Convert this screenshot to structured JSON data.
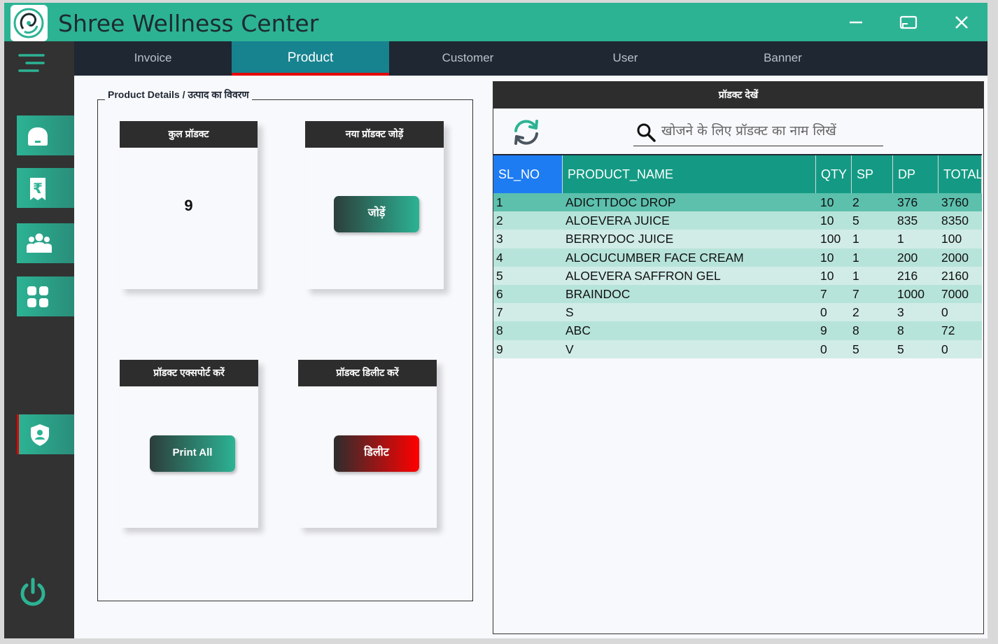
{
  "app": {
    "title": "Shree Wellness Center"
  },
  "window_controls": {
    "minimize": "minimize-icon",
    "restore": "restore-icon",
    "close": "close-icon"
  },
  "colors": {
    "accent": "#2cb394",
    "tab_active": "#17838f",
    "tab_indicator": "#e60000",
    "header_dark": "#2d2d2d",
    "table_header": "#149a84",
    "selected_header": "#1e7cf2"
  },
  "tabs": [
    {
      "label": "Invoice",
      "active": false
    },
    {
      "label": "Product",
      "active": true
    },
    {
      "label": "Customer",
      "active": false
    },
    {
      "label": "User",
      "active": false
    },
    {
      "label": "Banner",
      "active": false
    }
  ],
  "sidebar": {
    "items": [
      {
        "icon": "home-icon"
      },
      {
        "icon": "rupee-receipt-icon"
      },
      {
        "icon": "team-icon"
      },
      {
        "icon": "apps-grid-icon"
      },
      {
        "icon": "shield-user-icon"
      }
    ],
    "power_icon": "power-icon"
  },
  "details": {
    "legend": "Product Details / उत्पाद का विवरण",
    "total_card": {
      "title": "कुल प्रॉडक्ट",
      "count": "9"
    },
    "add_card": {
      "title": "नया प्रॉडक्ट जोड़ें",
      "button": "जोड़ें"
    },
    "export_card": {
      "title": "प्रॉडक्ट एक्सपोर्ट करें",
      "button": "Print All"
    },
    "delete_card": {
      "title": "प्रॉडक्ट डिलीट करें",
      "button": "डिलीट"
    }
  },
  "view": {
    "header": "प्रॉडक्ट देखें",
    "search_placeholder": "खोजने के लिए प्रॉडक्ट का नाम लिखें",
    "columns": [
      "SL_NO",
      "PRODUCT_NAME",
      "QTY",
      "SP",
      "DP",
      "TOTAL"
    ],
    "rows": [
      [
        "1",
        "ADICTTDOC DROP",
        "10",
        "2",
        "376",
        "3760"
      ],
      [
        "2",
        "ALOEVERA JUICE",
        "10",
        "5",
        "835",
        "8350"
      ],
      [
        "3",
        "BERRYDOC JUICE",
        "100",
        "1",
        "1",
        "100"
      ],
      [
        "4",
        "ALOCUCUMBER FACE CREAM",
        "10",
        "1",
        "200",
        "2000"
      ],
      [
        "5",
        "ALOEVERA SAFFRON GEL",
        "10",
        "1",
        "216",
        "2160"
      ],
      [
        "6",
        "BRAINDOC",
        "7",
        "7",
        "1000",
        "7000"
      ],
      [
        "7",
        "S",
        "0",
        "2",
        "3",
        "0"
      ],
      [
        "8",
        "ABC",
        "9",
        "8",
        "8",
        "72"
      ],
      [
        "9",
        "V",
        "0",
        "5",
        "5",
        "0"
      ]
    ]
  }
}
